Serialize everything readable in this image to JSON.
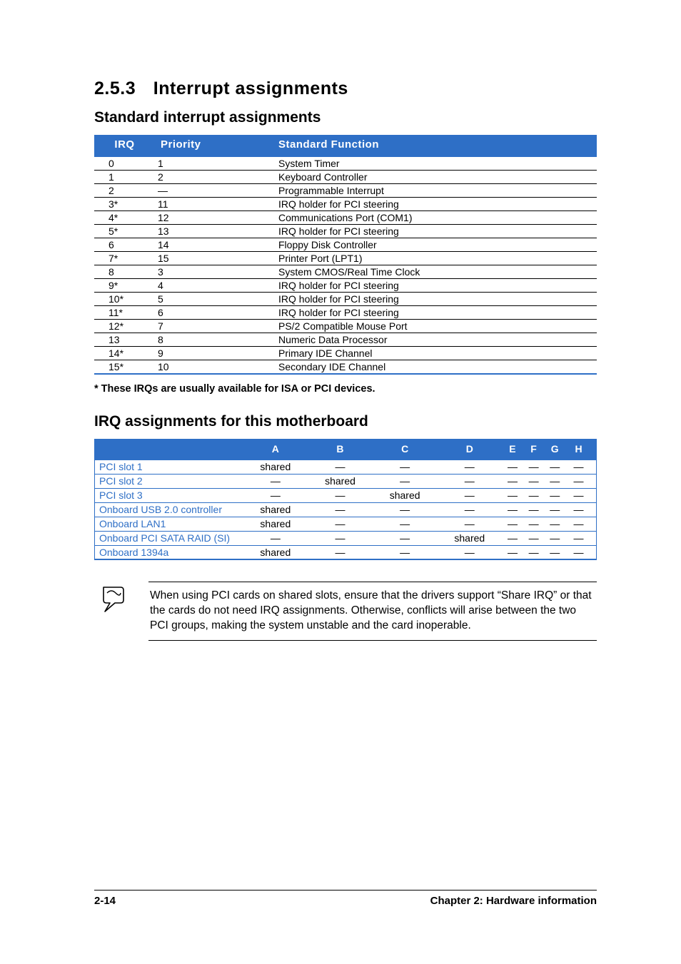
{
  "section": {
    "number": "2.5.3",
    "title": "Interrupt assignments"
  },
  "sub1": {
    "title": "Standard interrupt assignments"
  },
  "table1": {
    "head": {
      "irq": "IRQ",
      "prio": "Priority",
      "func": "Standard Function"
    },
    "rows": [
      {
        "irq": "0",
        "prio": "1",
        "func": "System Timer"
      },
      {
        "irq": "1",
        "prio": "2",
        "func": "Keyboard Controller"
      },
      {
        "irq": "2",
        "prio": "—",
        "func": "Programmable Interrupt"
      },
      {
        "irq": "3*",
        "prio": "11",
        "func": "IRQ holder for PCI steering"
      },
      {
        "irq": "4*",
        "prio": "12",
        "func": "Communications Port (COM1)"
      },
      {
        "irq": "5*",
        "prio": "13",
        "func": "IRQ holder for PCI steering"
      },
      {
        "irq": "6",
        "prio": "14",
        "func": "Floppy Disk Controller"
      },
      {
        "irq": "7*",
        "prio": "15",
        "func": "Printer Port (LPT1)"
      },
      {
        "irq": "8",
        "prio": "3",
        "func": "System CMOS/Real Time Clock"
      },
      {
        "irq": "9*",
        "prio": "4",
        "func": "IRQ holder for PCI steering"
      },
      {
        "irq": "10*",
        "prio": "5",
        "func": "IRQ holder for PCI steering"
      },
      {
        "irq": "11*",
        "prio": "6",
        "func": "IRQ holder for PCI steering"
      },
      {
        "irq": "12*",
        "prio": "7",
        "func": "PS/2 Compatible Mouse Port"
      },
      {
        "irq": "13",
        "prio": "8",
        "func": "Numeric Data Processor"
      },
      {
        "irq": "14*",
        "prio": "9",
        "func": "Primary IDE Channel"
      },
      {
        "irq": "15*",
        "prio": "10",
        "func": "Secondary IDE Channel"
      }
    ]
  },
  "footnote": "* These IRQs are usually available for ISA or PCI devices.",
  "sub2": {
    "title": "IRQ assignments for this motherboard"
  },
  "table2": {
    "cols": [
      "A",
      "B",
      "C",
      "D",
      "E",
      "F",
      "G",
      "H"
    ],
    "rows": [
      {
        "name": "PCI slot 1",
        "v": [
          "shared",
          "—",
          "—",
          "—",
          "—",
          "—",
          "—",
          "—"
        ]
      },
      {
        "name": "PCI slot 2",
        "v": [
          "—",
          "shared",
          "—",
          "—",
          "—",
          "—",
          "—",
          "—"
        ]
      },
      {
        "name": "PCI slot 3",
        "v": [
          "—",
          "—",
          "shared",
          "—",
          "—",
          "—",
          "—",
          "—"
        ]
      },
      {
        "name": "Onboard USB 2.0 controller",
        "v": [
          "shared",
          "—",
          "—",
          "—",
          "—",
          "—",
          "—",
          "—"
        ]
      },
      {
        "name": "Onboard LAN1",
        "v": [
          "shared",
          "—",
          "—",
          "—",
          "—",
          "—",
          "—",
          "—"
        ]
      },
      {
        "name": "Onboard PCI SATA RAID (SI)",
        "v": [
          "—",
          "—",
          "—",
          "shared",
          "—",
          "—",
          "—",
          "—"
        ]
      },
      {
        "name": "Onboard 1394a",
        "v": [
          "shared",
          "—",
          "—",
          "—",
          "—",
          "—",
          "—",
          "—"
        ]
      }
    ]
  },
  "note": "When using PCI cards on shared slots, ensure that the drivers support “Share IRQ” or that the cards do not need IRQ assignments. Otherwise, conflicts will arise between the two PCI groups, making the system unstable and the card inoperable.",
  "footer": {
    "page": "2-14",
    "chapter": "Chapter 2: Hardware information"
  }
}
